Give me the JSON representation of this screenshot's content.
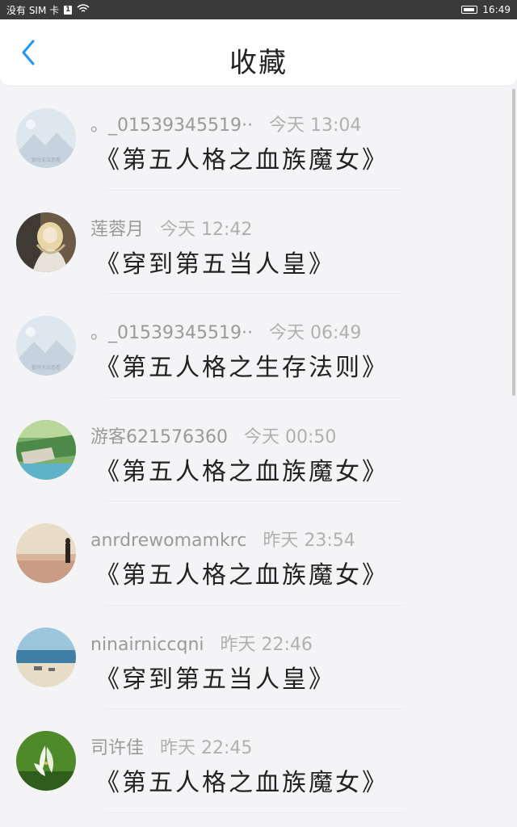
{
  "status_bar": {
    "carrier": "没有 SIM 卡",
    "sim_badge": "1",
    "time": "16:49"
  },
  "header": {
    "title": "收藏",
    "back_icon": "chevron-left-icon",
    "accent_color": "#2196f3"
  },
  "items": [
    {
      "user": "。_01539345519··",
      "time": "今天 13:04",
      "book": "《第五人格之血族魔女》",
      "avatar": "placeholder"
    },
    {
      "user": "莲蓉月",
      "time": "今天 12:42",
      "book": "《穿到第五当人皇》",
      "avatar": "anime-girl"
    },
    {
      "user": "。_01539345519··",
      "time": "今天 06:49",
      "book": "《第五人格之生存法则》",
      "avatar": "placeholder"
    },
    {
      "user": "游客621576360",
      "time": "今天 00:50",
      "book": "《第五人格之血族魔女》",
      "avatar": "landscape"
    },
    {
      "user": "anrdrewomamkrc",
      "time": "昨天 23:54",
      "book": "《第五人格之血族魔女》",
      "avatar": "beach-person"
    },
    {
      "user": "ninairniccqni",
      "time": "昨天 22:46",
      "book": "《穿到第五当人皇》",
      "avatar": "seaside"
    },
    {
      "user": "司许佳",
      "time": "昨天 22:45",
      "book": "《第五人格之血族魔女》",
      "avatar": "lily"
    }
  ],
  "placeholder_text": "暂时无法查看"
}
